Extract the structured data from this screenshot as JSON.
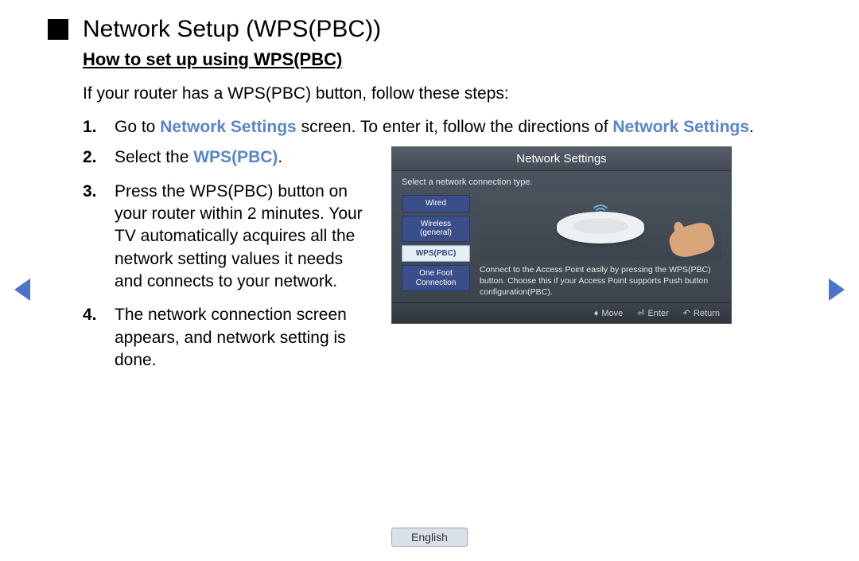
{
  "page": {
    "title": "Network Setup (WPS(PBC))",
    "subtitle": "How to set up using WPS(PBC)",
    "intro": "If your router has a WPS(PBC)  button, follow these steps:"
  },
  "steps": {
    "s1": {
      "num": "1.",
      "part1": "Go to ",
      "hl1": "Network Settings",
      "part2": " screen. To enter it, follow the directions of ",
      "hl2": "Network Settings",
      "part3": "."
    },
    "s2": {
      "num": "2.",
      "part1": "Select the ",
      "hl1": "WPS(PBC)",
      "part2": "."
    },
    "s3": {
      "num": "3.",
      "text": "Press the WPS(PBC) button on your router within 2 minutes. Your TV automatically acquires all the network setting values it needs and connects to your network."
    },
    "s4": {
      "num": "4.",
      "text": "The network connection screen appears, and network setting is done."
    }
  },
  "tv": {
    "title": "Network Settings",
    "prompt": "Select a network connection type.",
    "options": {
      "wired": "Wired",
      "wireless": "Wireless (general)",
      "wps": "WPS(PBC)",
      "onefoot": "One Foot Connection"
    },
    "description": "Connect to the Access Point easily by pressing the WPS(PBC) button. Choose this if your Access Point supports Push button configuration(PBC).",
    "footer": {
      "move": "Move",
      "enter": "Enter",
      "return": "Return"
    }
  },
  "language": "English"
}
